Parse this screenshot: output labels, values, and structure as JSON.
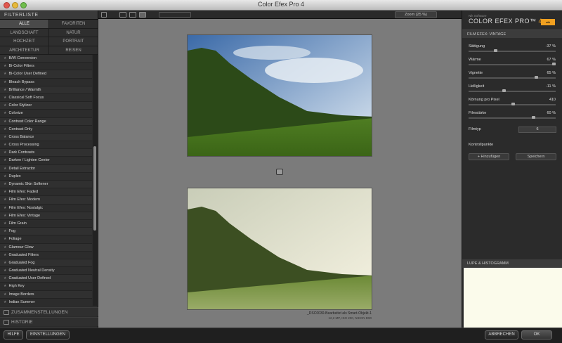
{
  "window": {
    "title": "Color Efex Pro 4"
  },
  "left": {
    "filterlist_label": "FILTERLISTE",
    "categories": [
      "ALLE",
      "FAVORITEN",
      "LANDSCHAFT",
      "NATUR",
      "HOCHZEIT",
      "PORTRAIT",
      "ARCHITEKTUR",
      "REISEN"
    ],
    "filters": [
      "B/W Conversion",
      "Bi-Color Filters",
      "Bi-Color User Defined",
      "Bleach Bypass",
      "Brilliance / Warmth",
      "Classical Soft Focus",
      "Color Stylizer",
      "Colorize",
      "Contrast Color Range",
      "Contrast Only",
      "Cross Balance",
      "Cross Processing",
      "Dark Contrasts",
      "Darken / Lighten Center",
      "Detail Extractor",
      "Duplex",
      "Dynamic Skin Softener",
      "Film Efex: Faded",
      "Film Efex: Modern",
      "Film Efex: Nostalgic",
      "Film Efex: Vintage",
      "Film Grain",
      "Fog",
      "Foliage",
      "Glamour Glow",
      "Graduated Filters",
      "Graduated Fog",
      "Graduated Neutral Density",
      "Graduated User Defined",
      "High Key",
      "Image Borders",
      "Indian Summer"
    ],
    "sec_zusammen": "ZUSAMMENSTELLUNGEN",
    "sec_historie": "HISTORIE"
  },
  "toolbar": {
    "zoom": "Zoom (25 %)"
  },
  "image": {
    "info1": "_DSC0030-Bearbeitet als Smart-Objekt-1",
    "info2": "12,2 MP, ISO 200, NIKON D90"
  },
  "right": {
    "brand_small": "Nik Software",
    "brand_name": "COLOR EFEX PRO™",
    "brand_ver": "4",
    "panel_title": "FILM EFEX: VINTAGE",
    "sliders": [
      {
        "label": "Sättigung",
        "value": "-37 %"
      },
      {
        "label": "Wärme",
        "value": "67 %"
      },
      {
        "label": "Vignette",
        "value": "65 %"
      },
      {
        "label": "Helligkeit",
        "value": "-11 %"
      },
      {
        "label": "Körnung pro Pixel",
        "value": "410"
      },
      {
        "label": "Filmstärke",
        "value": "60 %"
      }
    ],
    "filmtyp_label": "Filmtyp",
    "filmtyp_value": "6",
    "kontrollpunkte": "Kontrollpunkte",
    "add_label": "+ Hinzufügen",
    "save_label": "Speichern",
    "lupe_label": "LUPE & HISTOGRAMM"
  },
  "bottom": {
    "help": "HILFE",
    "settings": "EINSTELLUNGEN",
    "cancel": "ABBRECHEN",
    "ok": "OK"
  }
}
